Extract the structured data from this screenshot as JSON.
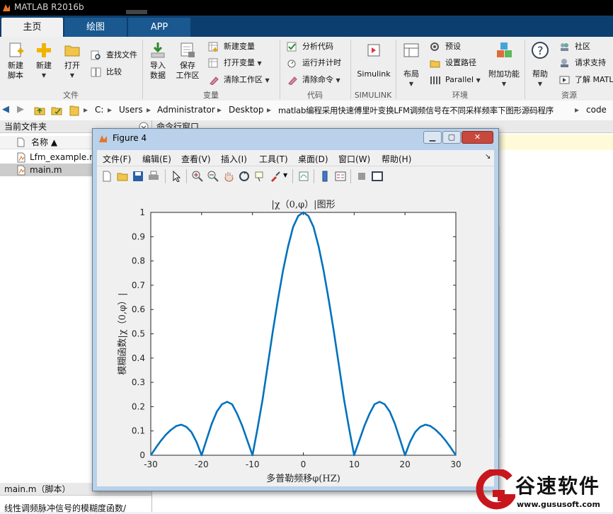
{
  "app": {
    "title": "MATLAB R2016b"
  },
  "tabs": [
    {
      "label": "主页",
      "active": true
    },
    {
      "label": "绘图",
      "active": false
    },
    {
      "label": "APP",
      "active": false
    }
  ],
  "ribbon": {
    "new_script": "新建\n脚本",
    "new": "新建",
    "open": "打开",
    "find_files": "查找文件",
    "compare": "比较",
    "import_data": "导入\n数据",
    "save_workspace": "保存\n工作区",
    "new_variable": "新建变量",
    "open_variable": "打开变量",
    "clear_workspace": "清除工作区",
    "analyze_code": "分析代码",
    "run_time": "运行并计时",
    "clear_commands": "清除命令",
    "simulink": "Simulink",
    "layout": "布局",
    "preferences": "预设",
    "set_path": "设置路径",
    "parallel": "Parallel",
    "addons": "附加功能",
    "help": "帮助",
    "community": "社区",
    "request_support": "请求支持",
    "learn_matlab": "了解 MATL",
    "groups": {
      "file": "文件",
      "variable": "变量",
      "code": "代码",
      "simulink": "SIMULINK",
      "environment": "环境",
      "resources": "资源"
    }
  },
  "address": {
    "drive": "C:",
    "parts": [
      "Users",
      "Administrator",
      "Desktop",
      "matlab编程采用快速傅里叶变换LFM调频信号在不同采样频率下图形源码程序",
      "code"
    ]
  },
  "left_panel": {
    "header": "当前文件夹",
    "col_name": "名称 ▲",
    "files": [
      {
        "name": "Lfm_example.m",
        "selected": false
      },
      {
        "name": "main.m",
        "selected": true
      }
    ],
    "details_header": "main.m（脚本）",
    "details_text": "线性调频脉冲信号的模糊度函数/"
  },
  "cmd_panel": {
    "header": "命令行窗口"
  },
  "figure": {
    "title": "Figure 4",
    "menus": [
      "文件(F)",
      "编辑(E)",
      "查看(V)",
      "插入(I)",
      "工具(T)",
      "桌面(D)",
      "窗口(W)",
      "帮助(H)"
    ]
  },
  "chart_data": {
    "type": "line",
    "title": "|χ（0,φ）|图形",
    "xlabel": "多普勒频移φ(HZ)",
    "ylabel": "模糊函数|χ（0,φ）|",
    "xlim": [
      -30,
      30
    ],
    "ylim": [
      0,
      1
    ],
    "xticks": [
      -30,
      -20,
      -10,
      0,
      10,
      20,
      30
    ],
    "yticks": [
      0,
      0.1,
      0.2,
      0.3,
      0.4,
      0.5,
      0.6,
      0.7,
      0.8,
      0.9,
      1
    ],
    "grid": false,
    "color": "#0072bd",
    "series": [
      {
        "x": [
          -30,
          -29,
          -28,
          -27,
          -26,
          -25,
          -24,
          -23,
          -22,
          -21,
          -20,
          -19,
          -18,
          -17,
          -16,
          -15,
          -14,
          -13,
          -12,
          -11,
          -10,
          -9,
          -8,
          -7,
          -6,
          -5,
          -4,
          -3,
          -2,
          -1,
          0,
          1,
          2,
          3,
          4,
          5,
          6,
          7,
          8,
          9,
          10,
          11,
          12,
          13,
          14,
          15,
          16,
          17,
          18,
          19,
          20,
          21,
          22,
          23,
          24,
          25,
          26,
          27,
          28,
          29,
          30
        ],
        "y": [
          0,
          0.031,
          0.06,
          0.085,
          0.105,
          0.12,
          0.126,
          0.117,
          0.095,
          0.055,
          0,
          0.066,
          0.13,
          0.18,
          0.21,
          0.22,
          0.21,
          0.17,
          0.12,
          0.06,
          0,
          0.11,
          0.23,
          0.37,
          0.51,
          0.64,
          0.76,
          0.86,
          0.94,
          0.985,
          1,
          0.985,
          0.94,
          0.86,
          0.76,
          0.64,
          0.51,
          0.37,
          0.23,
          0.11,
          0,
          0.06,
          0.12,
          0.17,
          0.21,
          0.22,
          0.21,
          0.18,
          0.13,
          0.066,
          0,
          0.055,
          0.095,
          0.117,
          0.126,
          0.12,
          0.105,
          0.085,
          0.06,
          0.031,
          0
        ]
      }
    ]
  },
  "watermark": {
    "brand": "谷速软件",
    "url": "www.gususoft.com"
  }
}
